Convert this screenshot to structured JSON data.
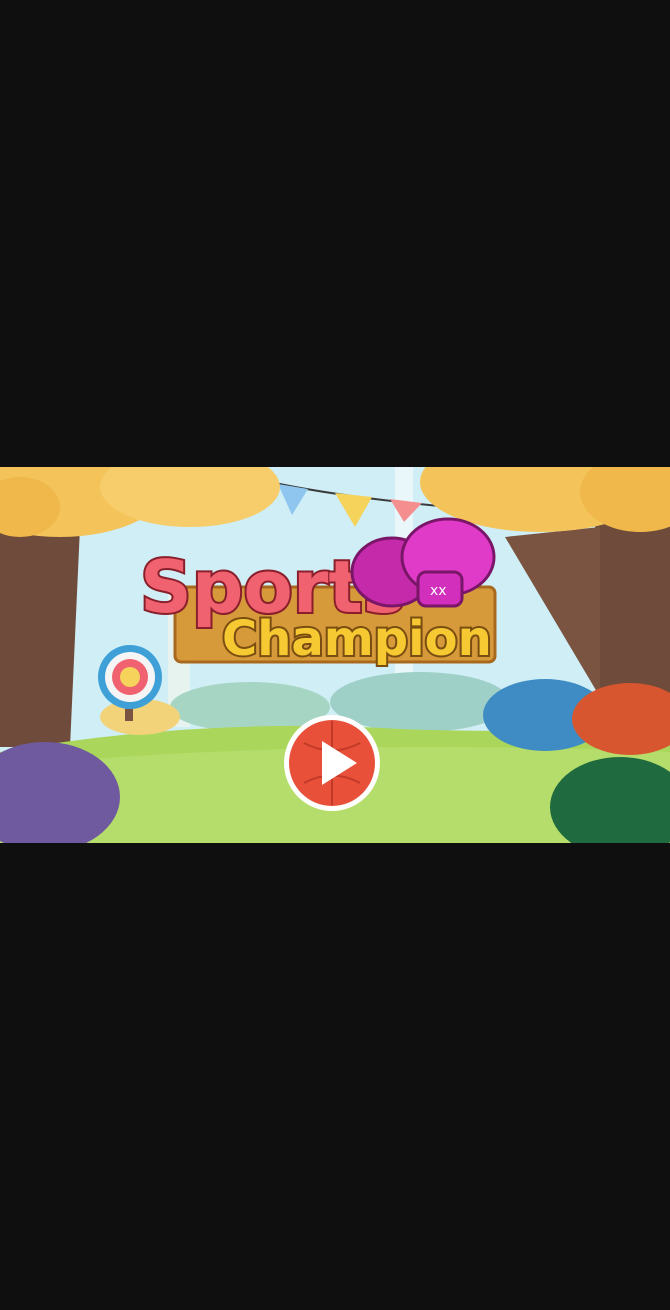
{
  "game": {
    "title_word1": "Sports",
    "title_word2": "Champion",
    "glove_mark": "xx"
  },
  "icons": {
    "play": "play-icon",
    "glove": "boxing-glove-icon",
    "target": "archery-target-icon"
  },
  "colors": {
    "letterbox": "#0f0f10",
    "sky": "#cfeef5",
    "grass": "#a9d65b",
    "sign_wood": "#d79a3a",
    "title_pink": "#f0626f",
    "title_blue": "#3fb6d8",
    "title_yellow": "#f6c932",
    "title_green": "#7ec943",
    "glove_magenta": "#d22fbd",
    "play_red": "#e8503a"
  }
}
